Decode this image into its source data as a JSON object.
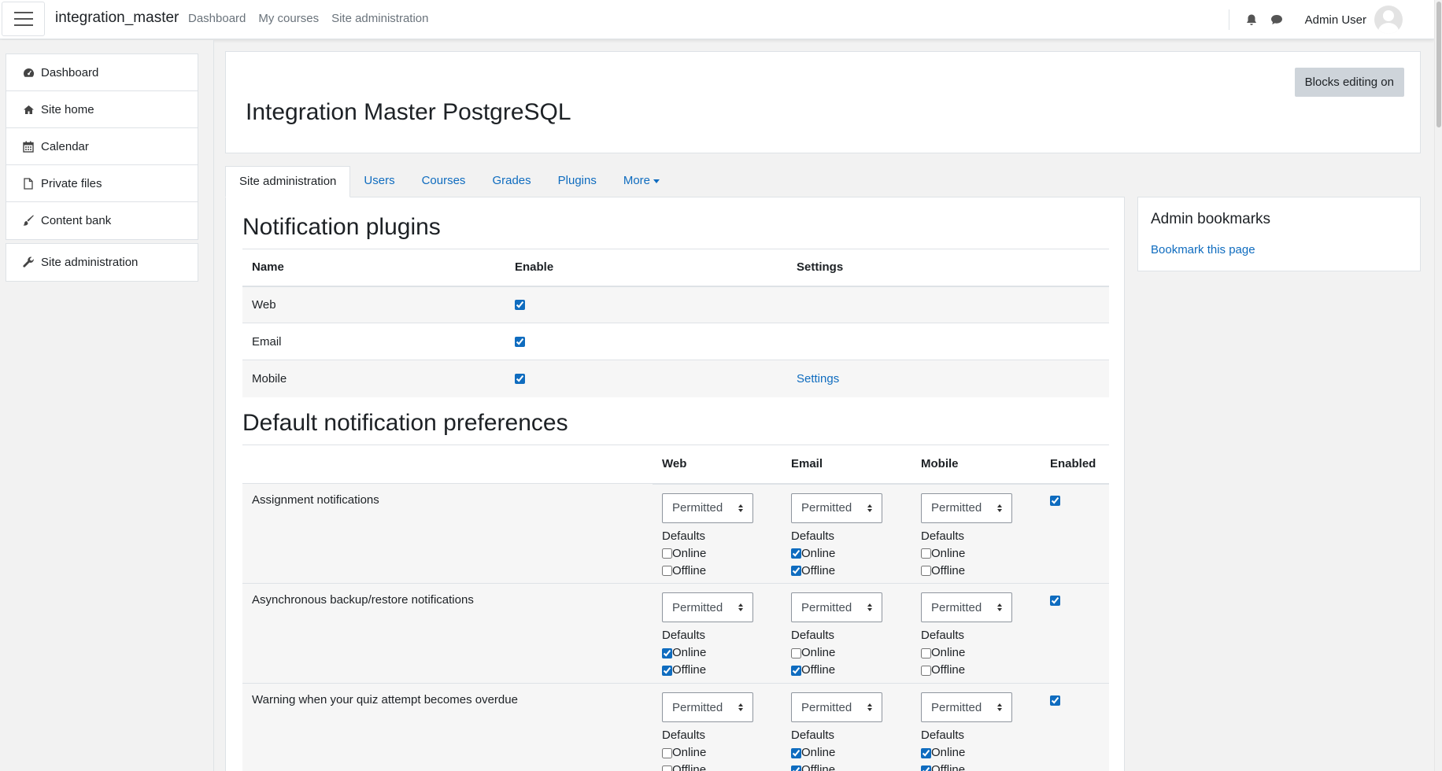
{
  "navbar": {
    "brand": "integration_master",
    "links": [
      "Dashboard",
      "My courses",
      "Site administration"
    ],
    "user_name": "Admin User",
    "icons": [
      "bell-icon",
      "chat-icon"
    ]
  },
  "sidebar": {
    "items": [
      {
        "label": "Dashboard",
        "icon": "dashboard-icon"
      },
      {
        "label": "Site home",
        "icon": "home-icon"
      },
      {
        "label": "Calendar",
        "icon": "calendar-icon"
      },
      {
        "label": "Private files",
        "icon": "file-icon"
      },
      {
        "label": "Content bank",
        "icon": "brush-icon"
      }
    ],
    "admin_item": {
      "label": "Site administration",
      "icon": "wrench-icon"
    }
  },
  "header": {
    "title": "Integration Master PostgreSQL",
    "editing_button": "Blocks editing on"
  },
  "tabs": [
    "Site administration",
    "Users",
    "Courses",
    "Grades",
    "Plugins",
    "More"
  ],
  "notification_plugins": {
    "heading": "Notification plugins",
    "columns": [
      "Name",
      "Enable",
      "Settings"
    ],
    "rows": [
      {
        "name": "Web",
        "enabled": true,
        "settings": ""
      },
      {
        "name": "Email",
        "enabled": true,
        "settings": ""
      },
      {
        "name": "Mobile",
        "enabled": true,
        "settings": "Settings"
      }
    ]
  },
  "default_prefs": {
    "heading": "Default notification preferences",
    "columns": [
      "",
      "Web",
      "Email",
      "Mobile",
      "Enabled"
    ],
    "select_value": "Permitted",
    "defaults_label": "Defaults",
    "online_label": "Online",
    "offline_label": "Offline",
    "rows": [
      {
        "name": "Assignment notifications",
        "enabled": true,
        "web": {
          "online": false,
          "offline": false
        },
        "email": {
          "online": true,
          "offline": true
        },
        "mobile": {
          "online": false,
          "offline": false
        }
      },
      {
        "name": "Asynchronous backup/restore notifications",
        "enabled": true,
        "web": {
          "online": true,
          "offline": true
        },
        "email": {
          "online": false,
          "offline": true
        },
        "mobile": {
          "online": false,
          "offline": false
        }
      },
      {
        "name": "Warning when your quiz attempt becomes overdue",
        "enabled": true,
        "web": {
          "online": false,
          "offline": false
        },
        "email": {
          "online": true,
          "offline": true
        },
        "mobile": {
          "online": true,
          "offline": true
        }
      }
    ]
  },
  "admin_bookmarks": {
    "title": "Admin bookmarks",
    "link": "Bookmark this page"
  },
  "colors": {
    "link": "#0f6cbf",
    "border": "#dee2e6",
    "button_bg": "#ced4da"
  }
}
